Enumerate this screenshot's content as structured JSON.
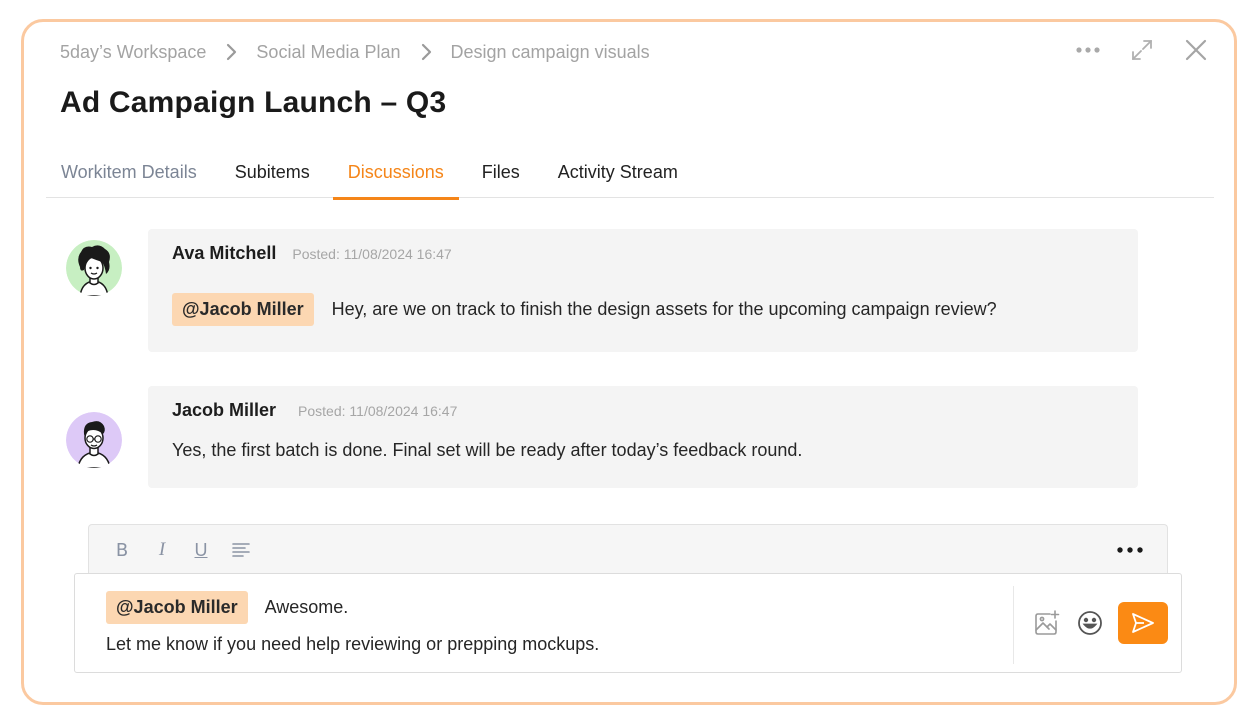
{
  "breadcrumb": [
    "5day’s Workspace",
    "Social Media Plan",
    "Design campaign visuals"
  ],
  "title": "Ad Campaign Launch – Q3",
  "tabs": [
    {
      "label": "Workitem Details",
      "state": "muted"
    },
    {
      "label": "Subitems",
      "state": "normal"
    },
    {
      "label": "Discussions",
      "state": "active"
    },
    {
      "label": "Files",
      "state": "normal"
    },
    {
      "label": "Activity Stream",
      "state": "normal"
    }
  ],
  "messages": [
    {
      "author": "Ava Mitchell",
      "posted": "Posted: 11/08/2024 16:47",
      "mention": "@Jacob Miller",
      "text": "Hey, are we on track to finish the design assets for the upcoming campaign review?",
      "avatar": "female-curly-hair-avatar"
    },
    {
      "author": "Jacob Miller",
      "posted": "Posted: 11/08/2024 16:47",
      "text": "Yes, the first batch is done. Final set will be ready after today’s feedback round.",
      "avatar": "male-glasses-avatar"
    }
  ],
  "editor": {
    "tools": [
      "bold-icon",
      "italic-icon",
      "underline-icon",
      "align-left-icon",
      "more-icon"
    ],
    "bold_glyph": "B",
    "italic_glyph": "I",
    "underline_glyph": "U",
    "draft_mention": "@Jacob Miller",
    "draft_line1": "Awesome.",
    "draft_line2": "Let me know if you need help reviewing or prepping mockups."
  },
  "colors": {
    "accent": "#f58518",
    "send_button": "#fb8a14",
    "panel_border": "#fbc9a0",
    "mention_bg": "#fcd7b2",
    "bubble_bg": "#f4f4f4"
  }
}
